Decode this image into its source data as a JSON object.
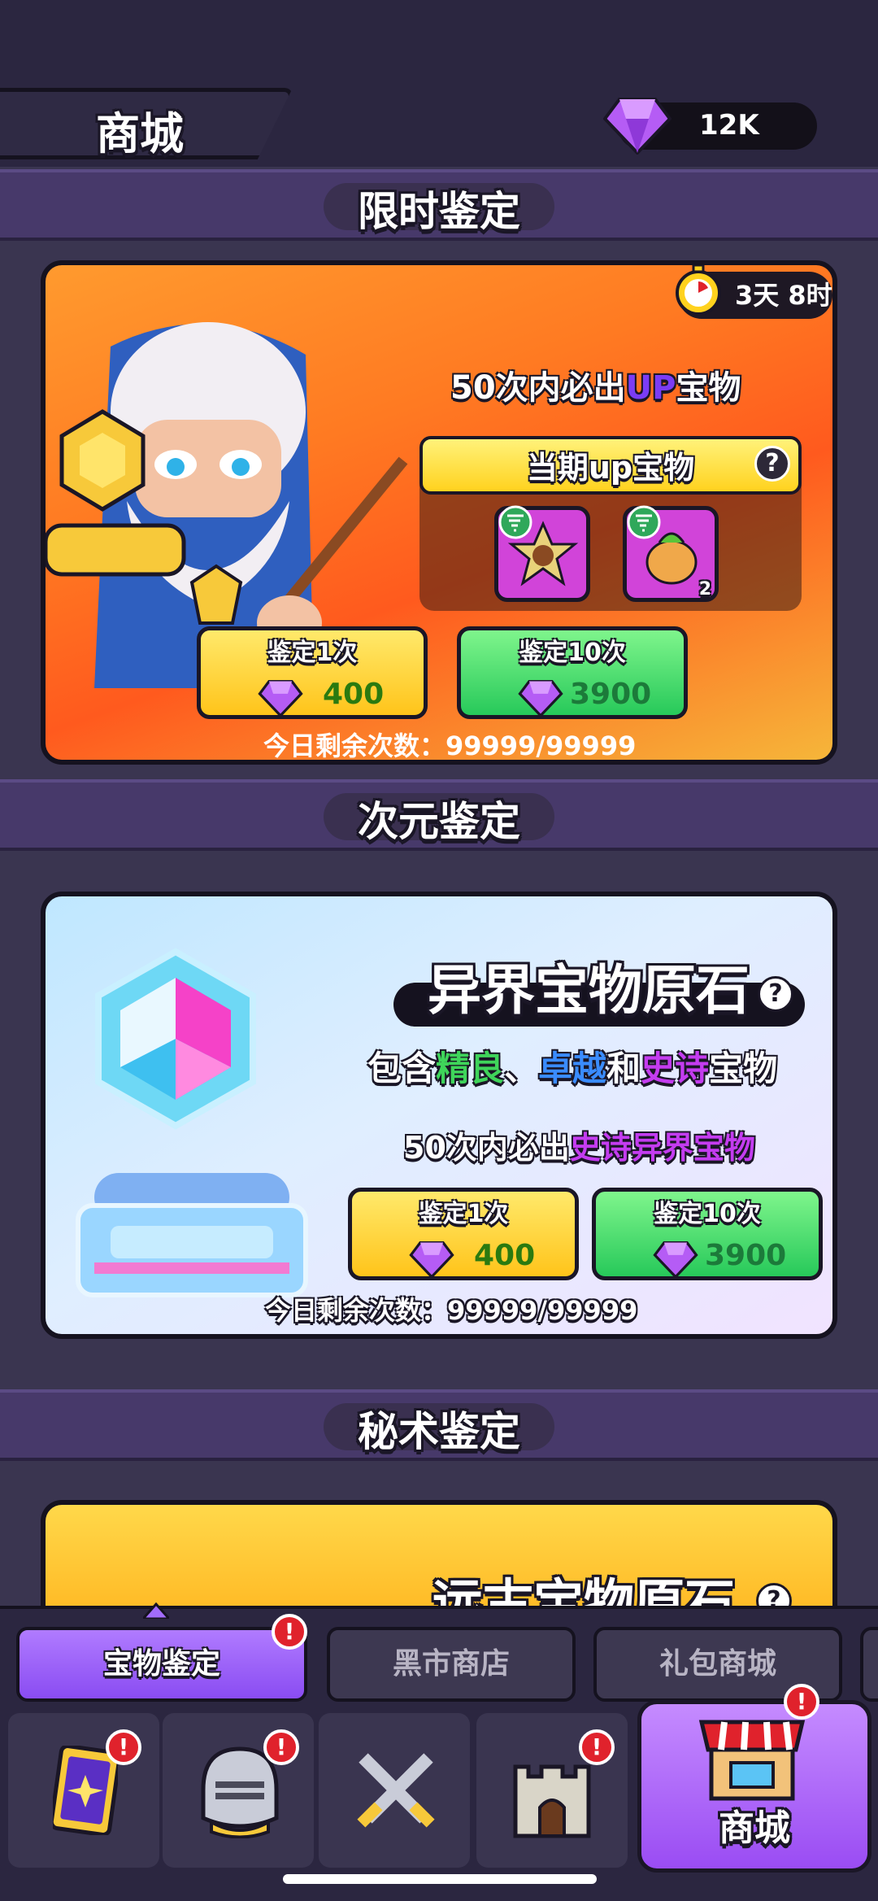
{
  "header": {
    "title": "商城",
    "gems": "12K"
  },
  "limited": {
    "banner": "限时鉴定",
    "timer": "3天 8时",
    "guarantee_prefix": "50次内必出",
    "guarantee_up": "UP",
    "guarantee_suffix": "宝物",
    "up_box_title": "当期up宝物",
    "help": "?",
    "item2_count": "2",
    "btn1_label": "鉴定1次",
    "btn1_price": "400",
    "btn10_label": "鉴定10次",
    "btn10_price": "3900",
    "remain": "今日剩余次数：99999/99999"
  },
  "dimension": {
    "banner": "次元鉴定",
    "title": "异界宝物原石",
    "help": "?",
    "desc_prefix": "包含",
    "desc_fine": "精良",
    "desc_sep": "、",
    "desc_excellent": "卓越",
    "desc_and": "和",
    "desc_epic": "史诗",
    "desc_suffix": "宝物",
    "guarantee_prefix": "50次内必出",
    "guarantee_highlight": "史诗异界宝物",
    "btn1_label": "鉴定1次",
    "btn1_price": "400",
    "btn10_label": "鉴定10次",
    "btn10_price": "3900",
    "remain": "今日剩余次数：99999/99999"
  },
  "arcane": {
    "banner": "秘术鉴定",
    "title": "远古宝物原石",
    "help": "?"
  },
  "subtabs": [
    {
      "label": "宝物鉴定",
      "active": true,
      "badge": "!"
    },
    {
      "label": "黑市商店",
      "active": false
    },
    {
      "label": "礼包商城",
      "active": false
    }
  ],
  "nav": {
    "cards_badge": "!",
    "hero_badge": "!",
    "castle_badge": "!",
    "shop_label": "商城",
    "shop_badge": "!"
  },
  "colors": {
    "up": "#7b3cf5",
    "fine": "#3fd45a",
    "excellent": "#3a8cff",
    "epic": "#c43cf0"
  }
}
